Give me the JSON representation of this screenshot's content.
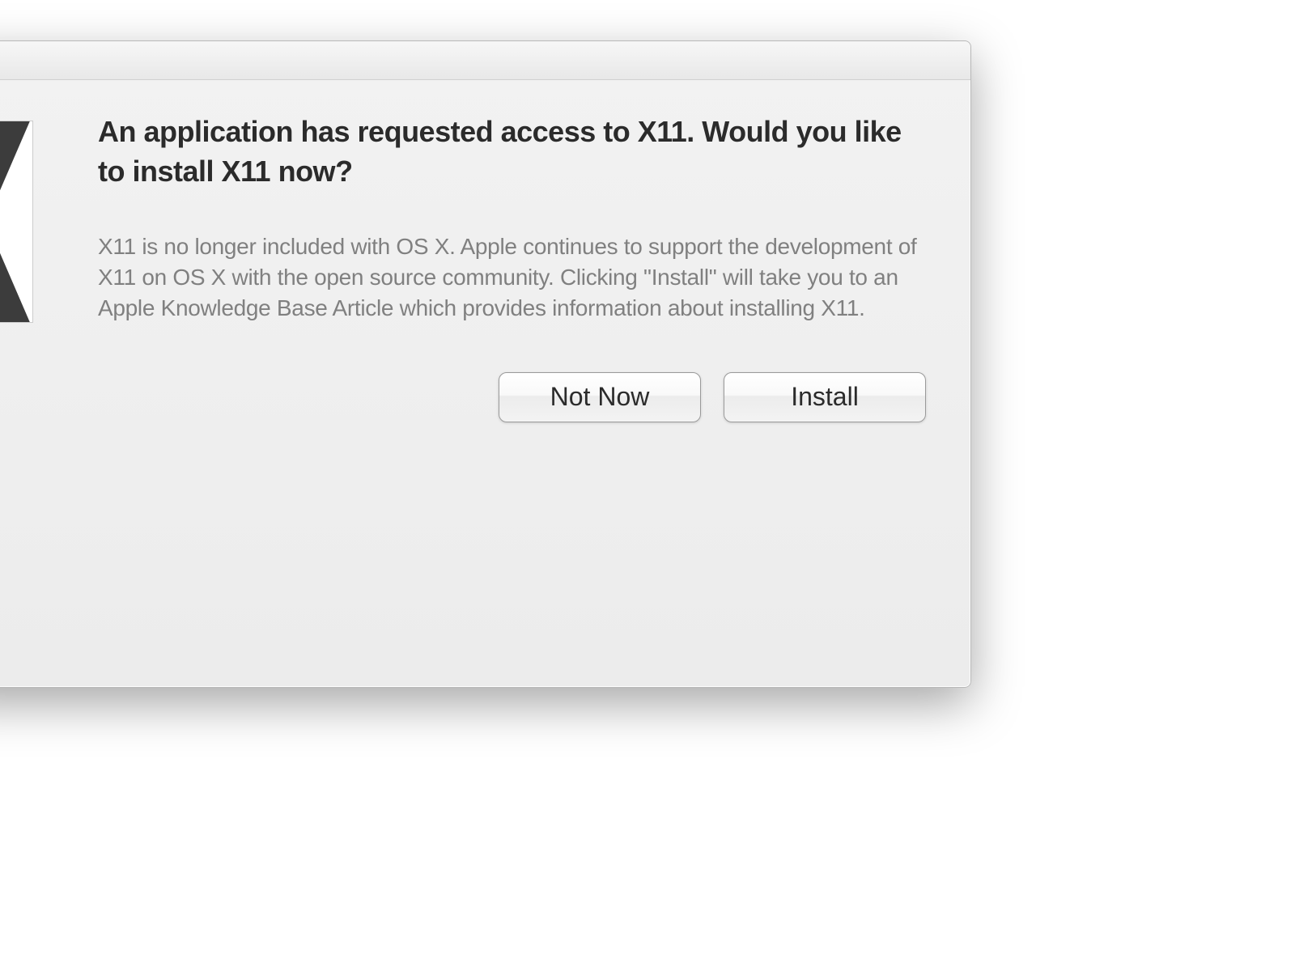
{
  "dialog": {
    "heading": "An application has requested access to X11. Would you like to install X11 now?",
    "body": "X11 is no longer included with OS X. Apple continues to support the development of X11 on OS X with the open source community. Clicking \"Install\" will take you to an Apple Knowledge Base Article which provides information about installing X11.",
    "icon_name": "x11-icon",
    "buttons": {
      "not_now": "Not Now",
      "install": "Install"
    }
  }
}
